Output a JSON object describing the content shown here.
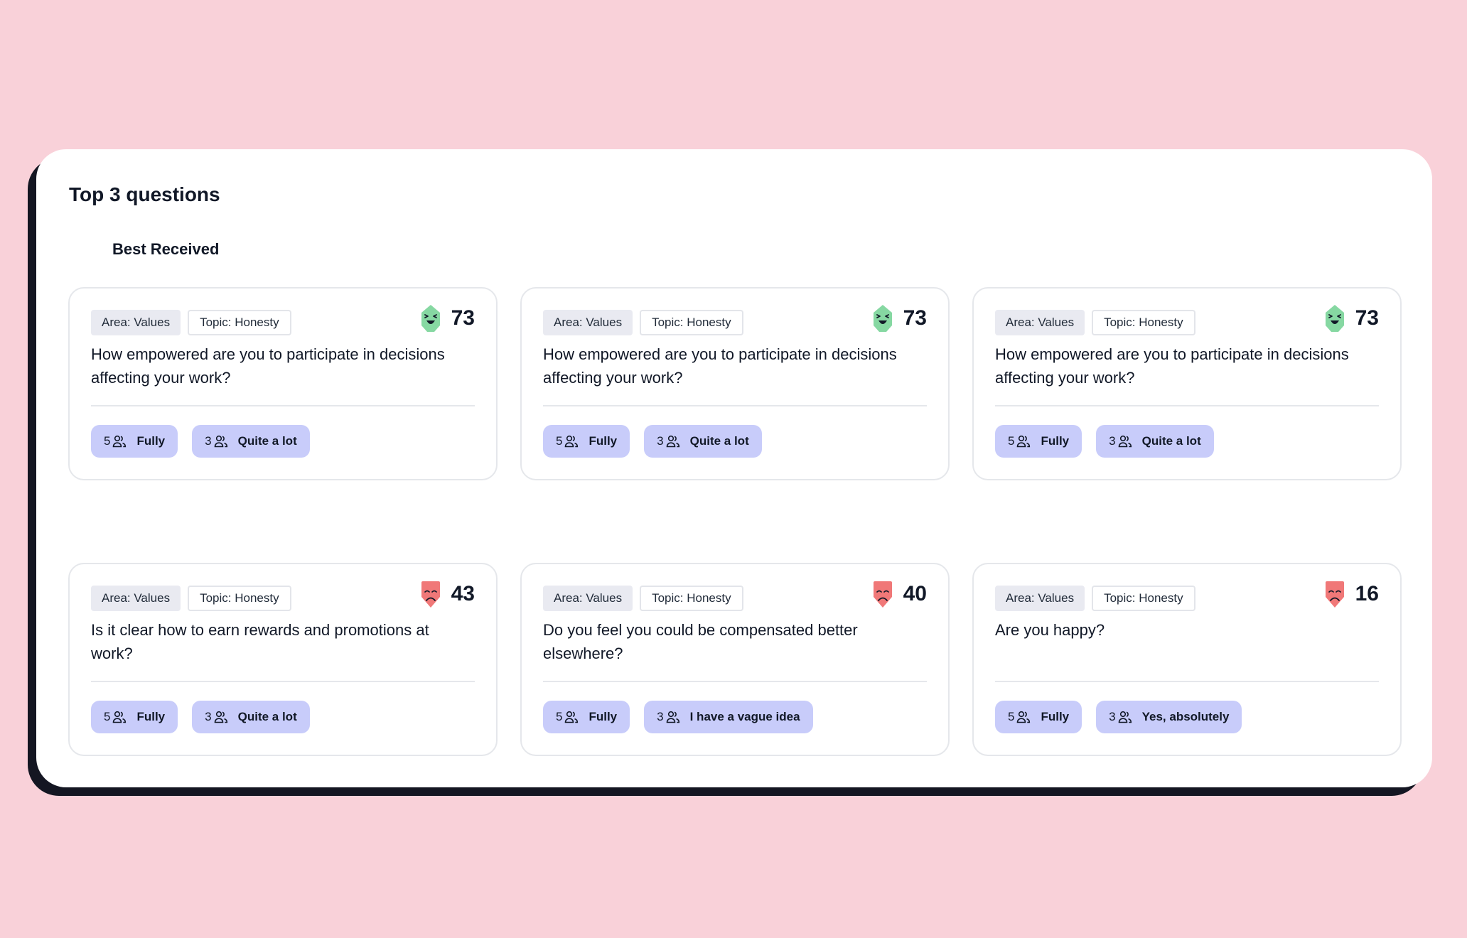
{
  "panel": {
    "title": "Top 3 questions",
    "section_label": "Best Received"
  },
  "colors": {
    "positive": "#86d8a2",
    "negative": "#f07878",
    "answer_bg": "#c8ccfa",
    "page_bg": "#f9d1d9"
  },
  "cards": [
    {
      "area": "Area: Values",
      "topic": "Topic: Honesty",
      "score": "73",
      "sentiment": "positive",
      "face_icon": "happy-face-icon",
      "question": "How empowered are you to participate in decisions affecting your work?",
      "answers": [
        {
          "count": "5",
          "label": "Fully"
        },
        {
          "count": "3",
          "label": "Quite a lot"
        }
      ]
    },
    {
      "area": "Area: Values",
      "topic": "Topic: Honesty",
      "score": "73",
      "sentiment": "positive",
      "face_icon": "happy-face-icon",
      "question": "How empowered are you to participate in decisions affecting your work?",
      "answers": [
        {
          "count": "5",
          "label": "Fully"
        },
        {
          "count": "3",
          "label": "Quite a lot"
        }
      ]
    },
    {
      "area": "Area: Values",
      "topic": "Topic: Honesty",
      "score": "73",
      "sentiment": "positive",
      "face_icon": "happy-face-icon",
      "question": "How empowered are you to participate in decisions affecting your work?",
      "answers": [
        {
          "count": "5",
          "label": "Fully"
        },
        {
          "count": "3",
          "label": "Quite a lot"
        }
      ]
    },
    {
      "area": "Area: Values",
      "topic": "Topic: Honesty",
      "score": "43",
      "sentiment": "negative",
      "face_icon": "sad-face-icon",
      "question": "Is it clear how to earn rewards and promotions at work?",
      "answers": [
        {
          "count": "5",
          "label": "Fully"
        },
        {
          "count": "3",
          "label": "Quite a lot"
        }
      ]
    },
    {
      "area": "Area: Values",
      "topic": "Topic: Honesty",
      "score": "40",
      "sentiment": "negative",
      "face_icon": "sad-face-icon",
      "question": "Do you feel you could be compensated better elsewhere?",
      "answers": [
        {
          "count": "5",
          "label": "Fully"
        },
        {
          "count": "3",
          "label": "I have a vague idea"
        }
      ]
    },
    {
      "area": "Area: Values",
      "topic": "Topic: Honesty",
      "score": "16",
      "sentiment": "negative",
      "face_icon": "sad-face-icon",
      "question": "Are you happy?",
      "answers": [
        {
          "count": "5",
          "label": "Fully"
        },
        {
          "count": "3",
          "label": "Yes, absolutely"
        }
      ]
    }
  ]
}
